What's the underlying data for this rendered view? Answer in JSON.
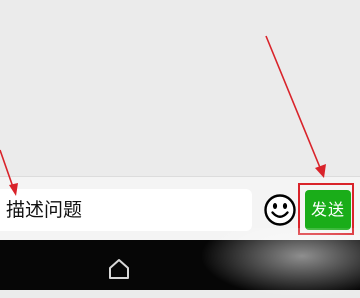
{
  "input_bar": {
    "message_value": "描述问题",
    "send_label": "发送"
  },
  "icons": {
    "emoji": "smiley-face-icon",
    "home": "home-icon"
  },
  "colors": {
    "send_button": "#1aad19",
    "annotation": "#d9232a",
    "nav_bar": "#060606"
  }
}
